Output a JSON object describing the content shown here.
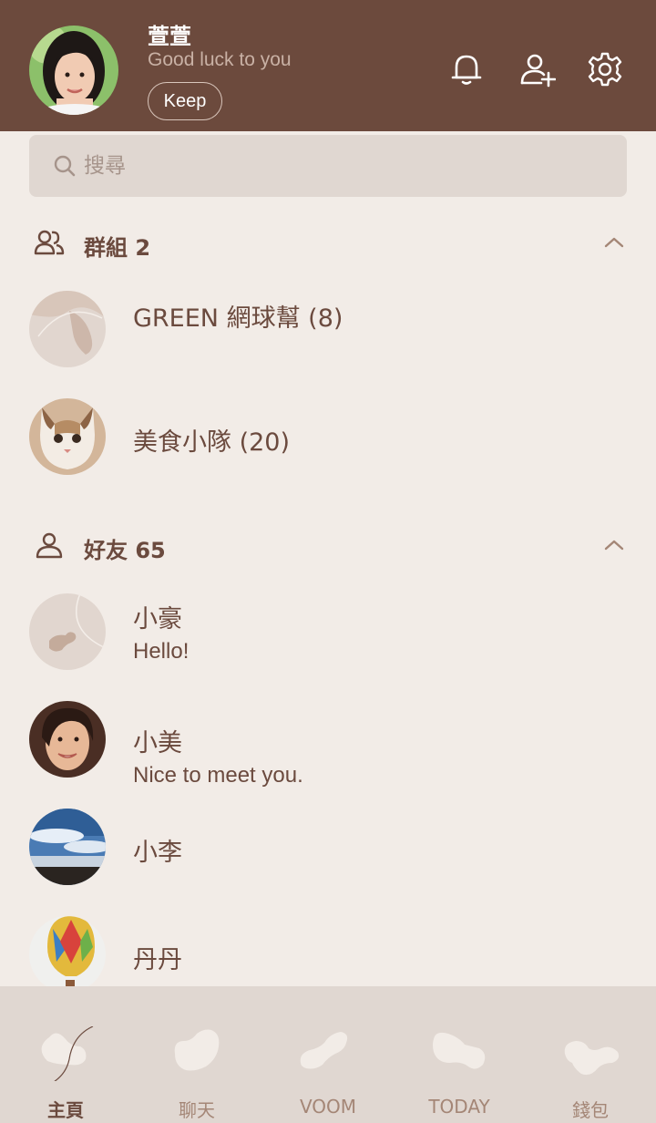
{
  "profile": {
    "name": "萱萱",
    "status": "Good luck to you",
    "keep_label": "Keep"
  },
  "header_icons": [
    "bell-icon",
    "add-friend-icon",
    "gear-icon"
  ],
  "search": {
    "placeholder": "搜尋"
  },
  "groups": {
    "title": "群組 2",
    "items": [
      {
        "name": "GREEN 網球幫 (8)"
      },
      {
        "name": "美食小隊 (20)"
      }
    ]
  },
  "friends": {
    "title": "好友 65",
    "items": [
      {
        "name": "小豪",
        "message": "Hello!"
      },
      {
        "name": "小美",
        "message": "Nice to meet you."
      },
      {
        "name": "小李",
        "message": ""
      },
      {
        "name": "丹丹",
        "message": ""
      }
    ]
  },
  "nav": {
    "tabs": [
      {
        "label": "主頁",
        "active": true
      },
      {
        "label": "聊天",
        "active": false
      },
      {
        "label": "VOOM",
        "active": false
      },
      {
        "label": "TODAY",
        "active": false
      },
      {
        "label": "錢包",
        "active": false
      }
    ]
  },
  "colors": {
    "header_bg": "#6c4a3d",
    "page_bg": "#f2ece7",
    "search_bg": "#e0d7d1",
    "text_brown": "#6b4a3e",
    "nav_label": "#a48676"
  }
}
